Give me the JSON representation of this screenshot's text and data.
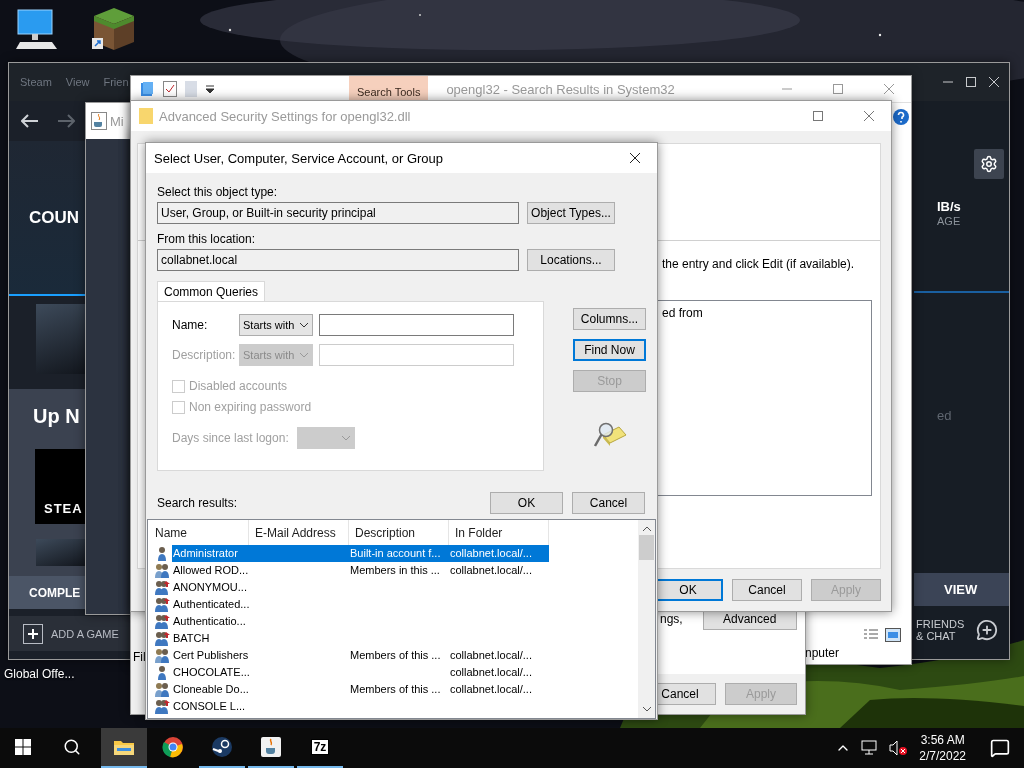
{
  "desktop": {
    "icons": [
      {
        "kind": "computer"
      },
      {
        "kind": "grass-block"
      }
    ],
    "caption": "Global Offe..."
  },
  "steam": {
    "menu": [
      "Steam",
      "View",
      "Frien"
    ],
    "banner": "COUN",
    "up_next": "Up N",
    "tile": "STEA",
    "complete": "COMPLE",
    "add_game": "ADD A GAME",
    "speed": "IB/s",
    "storage": "AGE",
    "status": "ed",
    "view": "VIEW",
    "friends": "FRIENDS & CHAT"
  },
  "minecraft_window": {
    "title": "Mi"
  },
  "explorer": {
    "contextual_tab": "Search Tools",
    "title": "opengl32 - Search Results in System32",
    "status": "nputer"
  },
  "properties_window": {
    "status": "Fil",
    "note": "ngs,",
    "advanced_button": "Advanced",
    "buttons": [
      {
        "label": "Cancel",
        "disabled": false
      },
      {
        "label": "Apply",
        "disabled": true
      }
    ]
  },
  "advanced_security": {
    "title": "Advanced Security Settings for opengl32.dll",
    "instruction": "the entry and click Edit (if available).",
    "column": "ed from",
    "buttons": [
      {
        "label": "OK",
        "default": true,
        "disabled": false
      },
      {
        "label": "Cancel",
        "default": false,
        "disabled": false
      },
      {
        "label": "Apply",
        "default": false,
        "disabled": true
      }
    ]
  },
  "dialog": {
    "title": "Select User, Computer, Service Account, or Group",
    "object_type_label": "Select this object type:",
    "object_type": "User, Group, or Built-in security principal",
    "object_types_button": "Object Types...",
    "location_label": "From this location:",
    "location": "collabnet.local",
    "locations_button": "Locations...",
    "tab": "Common Queries",
    "queries": [
      {
        "label": "Name:",
        "mode": "Starts with",
        "disabled": false
      },
      {
        "label": "Description:",
        "mode": "Starts with",
        "disabled": true
      }
    ],
    "checkboxes": [
      {
        "label": "Disabled accounts",
        "checked": false,
        "disabled": true
      },
      {
        "label": "Non expiring password",
        "checked": false,
        "disabled": true
      }
    ],
    "days": {
      "label": "Days since last logon:",
      "disabled": true
    },
    "side_buttons": [
      {
        "label": "Columns...",
        "default": false,
        "disabled": false
      },
      {
        "label": "Find Now",
        "default": true,
        "disabled": false
      },
      {
        "label": "Stop",
        "default": false,
        "disabled": true
      }
    ],
    "ok": "OK",
    "cancel": "Cancel",
    "results_label": "Search results:",
    "columns": [
      "Name",
      "E-Mail Address",
      "Description",
      "In Folder"
    ],
    "rows": [
      {
        "kind": "user",
        "name": "Administrator",
        "description": "Built-in account f...",
        "folder": "collabnet.local/...",
        "selected": true
      },
      {
        "kind": "group",
        "name": "Allowed ROD...",
        "description": "Members in this ...",
        "folder": "collabnet.local/...",
        "selected": false
      },
      {
        "kind": "builtin",
        "name": "ANONYMOU...",
        "selected": false
      },
      {
        "kind": "builtin",
        "name": "Authenticated...",
        "selected": false
      },
      {
        "kind": "builtin",
        "name": "Authenticatio...",
        "selected": false
      },
      {
        "kind": "builtin",
        "name": "BATCH",
        "selected": false
      },
      {
        "kind": "group",
        "name": "Cert Publishers",
        "description": "Members of this ...",
        "folder": "collabnet.local/...",
        "selected": false
      },
      {
        "kind": "user",
        "name": "CHOCOLATE...",
        "folder": "collabnet.local/...",
        "selected": false
      },
      {
        "kind": "group",
        "name": "Cloneable Do...",
        "description": "Members of this ...",
        "folder": "collabnet.local/...",
        "selected": false
      },
      {
        "kind": "builtin",
        "name": "CONSOLE L...",
        "selected": false
      }
    ]
  },
  "taskbar": {
    "apps": [
      {
        "kind": "explorer",
        "running": true,
        "focused": true
      },
      {
        "kind": "chrome",
        "running": false,
        "focused": false
      },
      {
        "kind": "steam",
        "running": true,
        "focused": false
      },
      {
        "kind": "java",
        "running": true,
        "focused": false
      },
      {
        "kind": "archiver",
        "label": "7z",
        "running": true,
        "focused": false
      }
    ],
    "time": "3:56 AM",
    "date": "2/7/2022"
  }
}
